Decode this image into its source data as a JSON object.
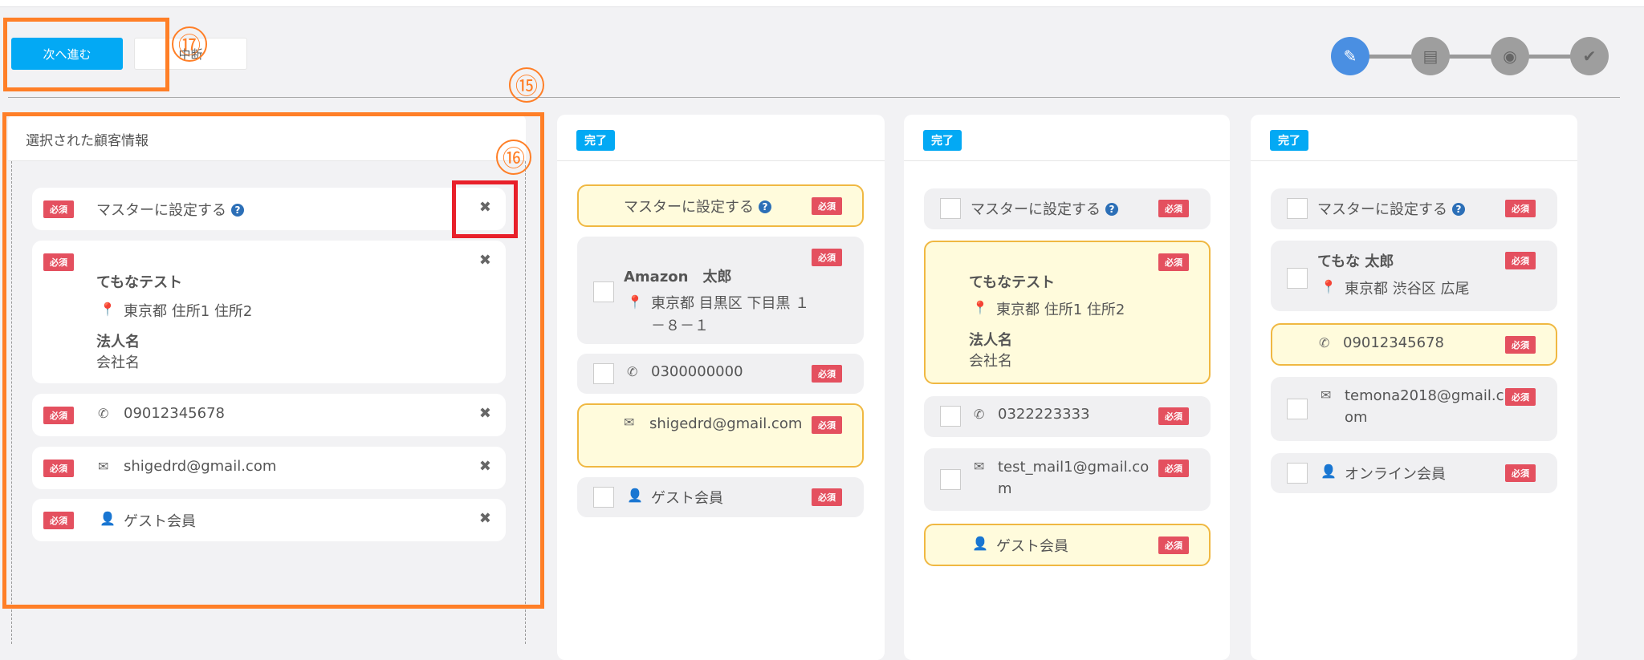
{
  "toolbar": {
    "next_label": "次へ進む",
    "stop_label": "中断"
  },
  "steps": [
    {
      "icon": "edit-icon",
      "active": true
    },
    {
      "icon": "list-icon"
    },
    {
      "icon": "eye-icon"
    },
    {
      "icon": "check-icon"
    }
  ],
  "required_label": "必須",
  "done_label": "完了",
  "selected": {
    "title": "選択された顧客情報",
    "master": "マスターに設定する",
    "name": "てもなテスト",
    "address": "東京都 住所1 住所2",
    "corp_label": "法人名",
    "corp_value": "会社名",
    "phone": "09012345678",
    "email": "shigedrd@gmail.com",
    "member": "ゲスト会員"
  },
  "candidates": [
    {
      "master": "マスターに設定する",
      "name": "Amazon　太郎",
      "address": "東京都 目黒区 下目黒 １－８－１",
      "phone": "0300000000",
      "email": "shigedrd@gmail.com",
      "member": "ゲスト会員"
    },
    {
      "master": "マスターに設定する",
      "name": "てもなテスト",
      "address": "東京都 住所1 住所2",
      "corp_label": "法人名",
      "corp_value": "会社名",
      "phone": "0322223333",
      "email": "test_mail1@gmail.com",
      "member": "ゲスト会員"
    },
    {
      "master": "マスターに設定する",
      "name": "てもな 太郎",
      "address": "東京都 渋谷区 広尾",
      "phone": "09012345678",
      "email": "temona2018@gmail.com",
      "member": "オンライン会員"
    }
  ],
  "annotations": {
    "a15": "⑮",
    "a16": "⑯",
    "a17": "⑰"
  }
}
